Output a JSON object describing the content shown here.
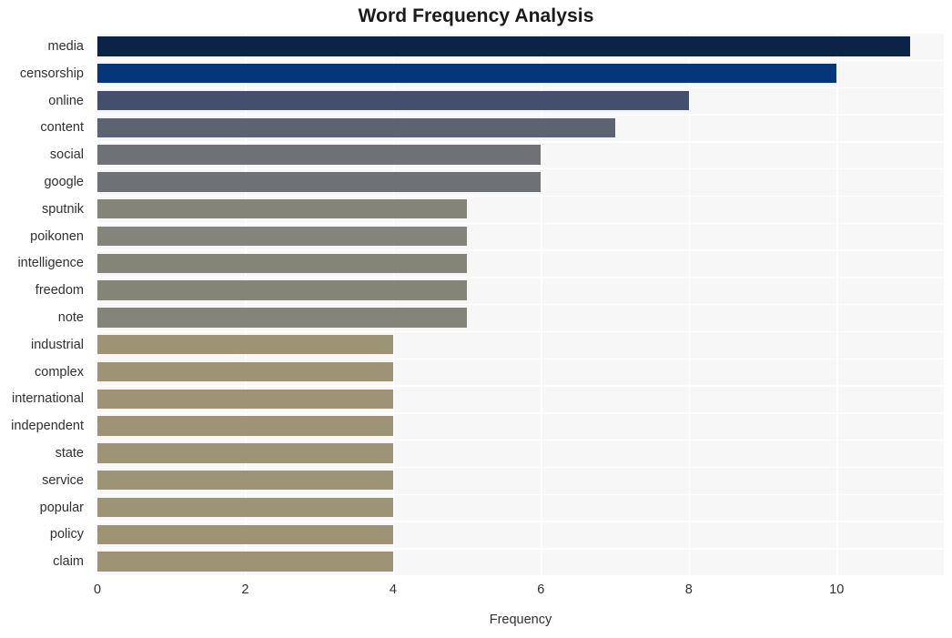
{
  "chart_data": {
    "type": "bar",
    "orientation": "horizontal",
    "title": "Word Frequency Analysis",
    "xlabel": "Frequency",
    "ylabel": "",
    "xlim": [
      0,
      11.45
    ],
    "ylim": null,
    "grid": true,
    "grid_color": "#ffffff",
    "plot_background": "#f7f7f7",
    "figure_background": "#ffffff",
    "legend": null,
    "xticks": [
      0,
      2,
      4,
      6,
      8,
      10
    ],
    "xtick_labels": [
      "0",
      "2",
      "4",
      "6",
      "8",
      "10"
    ],
    "categories": [
      "media",
      "censorship",
      "online",
      "content",
      "social",
      "google",
      "sputnik",
      "poikonen",
      "intelligence",
      "freedom",
      "note",
      "industrial",
      "complex",
      "international",
      "independent",
      "state",
      "service",
      "popular",
      "policy",
      "claim"
    ],
    "values": [
      11,
      10,
      8,
      7,
      6,
      6,
      5,
      5,
      5,
      5,
      5,
      4,
      4,
      4,
      4,
      4,
      4,
      4,
      4,
      4
    ],
    "bar_colors": [
      "#0a2347",
      "#05357a",
      "#454f6d",
      "#5d6372",
      "#6e7175",
      "#6e7175",
      "#848478",
      "#848478",
      "#848478",
      "#848478",
      "#848478",
      "#9d9375",
      "#9d9375",
      "#9d9375",
      "#9d9375",
      "#9d9375",
      "#9d9375",
      "#9d9375",
      "#9d9375",
      "#9d9375"
    ],
    "data_labels": []
  }
}
